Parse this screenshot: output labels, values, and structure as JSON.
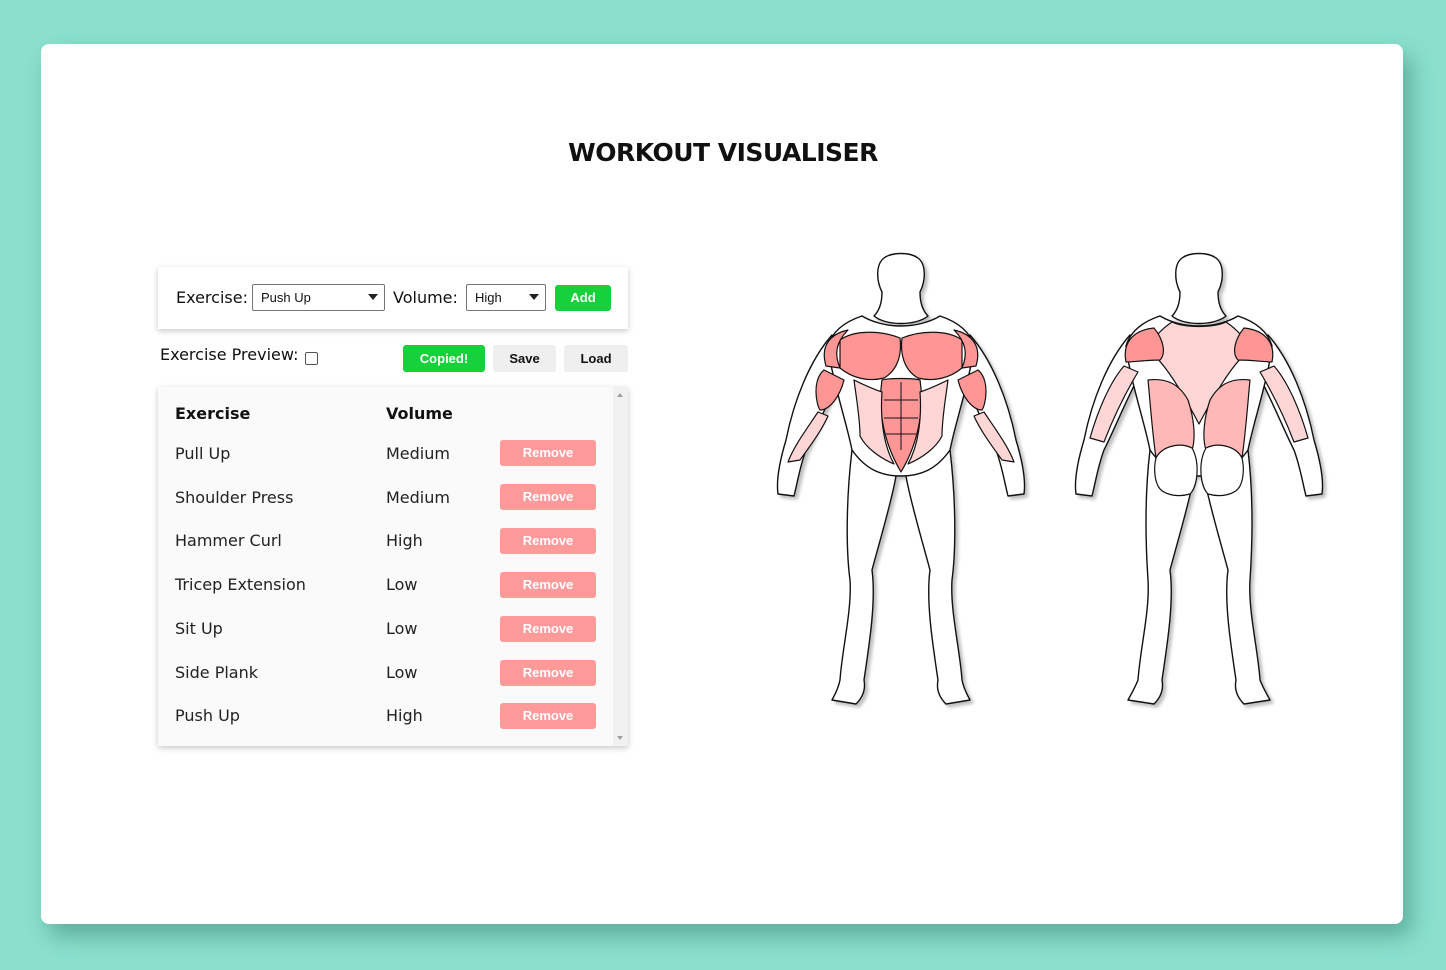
{
  "page": {
    "title": "WORKOUT VISUALISER"
  },
  "controls": {
    "exercise_label": "Exercise:",
    "exercise_selected": "Push Up",
    "volume_label": "Volume:",
    "volume_selected": "High",
    "add_label": "Add"
  },
  "preview": {
    "label": "Exercise Preview:",
    "checked": false,
    "copied_label": "Copied!",
    "save_label": "Save",
    "load_label": "Load"
  },
  "table": {
    "headers": {
      "exercise": "Exercise",
      "volume": "Volume"
    },
    "remove_label": "Remove",
    "rows": [
      {
        "exercise": "Pull Up",
        "volume": "Medium"
      },
      {
        "exercise": "Shoulder Press",
        "volume": "Medium"
      },
      {
        "exercise": "Hammer Curl",
        "volume": "High"
      },
      {
        "exercise": "Tricep Extension",
        "volume": "Low"
      },
      {
        "exercise": "Sit Up",
        "volume": "Low"
      },
      {
        "exercise": "Side Plank",
        "volume": "Low"
      },
      {
        "exercise": "Push Up",
        "volume": "High"
      }
    ]
  },
  "colors": {
    "background": "#8ae0cd",
    "add_green": "#16d13b",
    "remove_pink": "#ff9a9a",
    "muscle_high": "#ff9696",
    "muscle_medium": "#ffb8b8",
    "muscle_low": "#ffd6d6"
  }
}
